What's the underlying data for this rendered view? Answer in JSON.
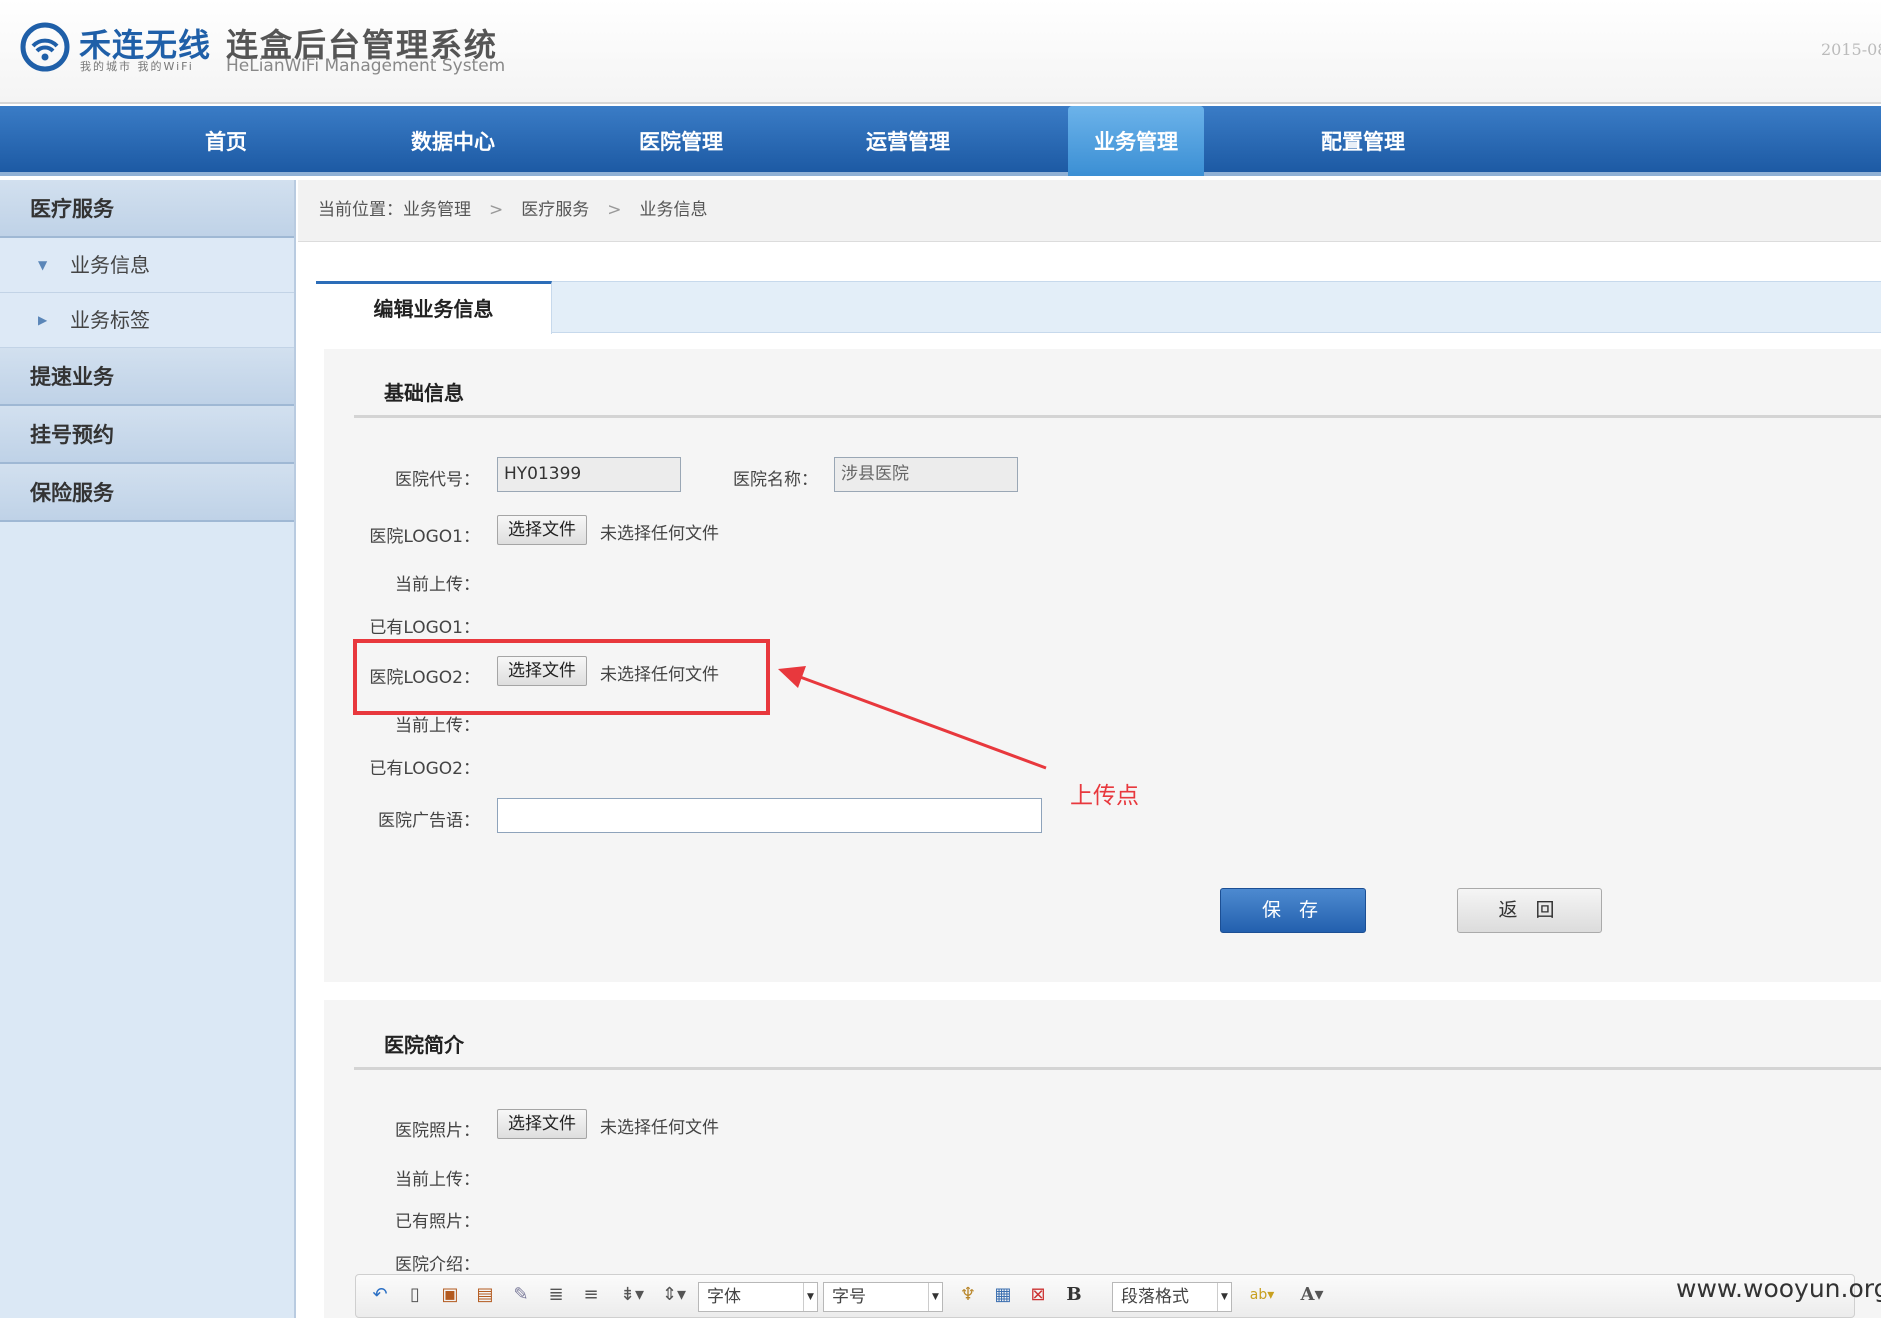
{
  "header": {
    "brand_name": "禾连无线",
    "brand_tagline": "我的城市  我的WiFi",
    "system_title": "连盒后台管理系统",
    "system_subtitle": "HeLianWiFi Management System",
    "date_fragment": "2015-08"
  },
  "nav": {
    "items": [
      {
        "label": "首页"
      },
      {
        "label": "数据中心"
      },
      {
        "label": "医院管理"
      },
      {
        "label": "运营管理"
      },
      {
        "label": "业务管理",
        "active": true
      },
      {
        "label": "配置管理"
      }
    ],
    "accent": "#1d5aa4"
  },
  "sidebar": {
    "groups": [
      {
        "label": "医疗服务",
        "children": [
          {
            "label": "业务信息",
            "expanded": true
          },
          {
            "label": "业务标签",
            "expanded": false
          }
        ]
      },
      {
        "label": "提速业务"
      },
      {
        "label": "挂号预约"
      },
      {
        "label": "保险服务"
      }
    ]
  },
  "breadcrumb": {
    "prefix": "当前位置：",
    "items": [
      "业务管理",
      "医疗服务",
      "业务信息"
    ],
    "separator": ">"
  },
  "tab": {
    "label": "编辑业务信息"
  },
  "basic": {
    "title": "基础信息",
    "hospital_code_label": "医院代号：",
    "hospital_code_value": "HY01399",
    "hospital_name_label": "医院名称：",
    "hospital_name_value": "涉县医院",
    "logo1_label": "医院LOGO1：",
    "logo2_label": "医院LOGO2：",
    "choose_file": "选择文件",
    "no_file": "未选择任何文件",
    "current_upload_label": "当前上传：",
    "existing_logo1_label": "已有LOGO1：",
    "existing_logo2_label": "已有LOGO2：",
    "slogan_label": "医院广告语：",
    "slogan_value": "",
    "save_label": "保 存",
    "back_label": "返 回"
  },
  "intro": {
    "title": "医院简介",
    "photo_label": "医院照片：",
    "current_upload_label": "当前上传：",
    "existing_photo_label": "已有照片：",
    "intro_label": "医院介绍："
  },
  "editor_toolbar": {
    "font_label": "字体",
    "size_label": "字号",
    "paragraph_label": "段落格式",
    "bold_label": "B",
    "font_color_label": "A",
    "icons": [
      "undo-icon",
      "new-document-icon",
      "insert-image-icon",
      "insert-multi-image-icon",
      "eraser-icon",
      "align-center-icon",
      "align-justify-icon",
      "paragraph-spacing-icon",
      "line-height-icon",
      "format-brush-icon",
      "table-icon",
      "delete-table-icon",
      "spellcheck-icon"
    ]
  },
  "annotation": {
    "text": "上传点",
    "color": "#e8383d"
  },
  "watermark": "www.wooyun.org"
}
